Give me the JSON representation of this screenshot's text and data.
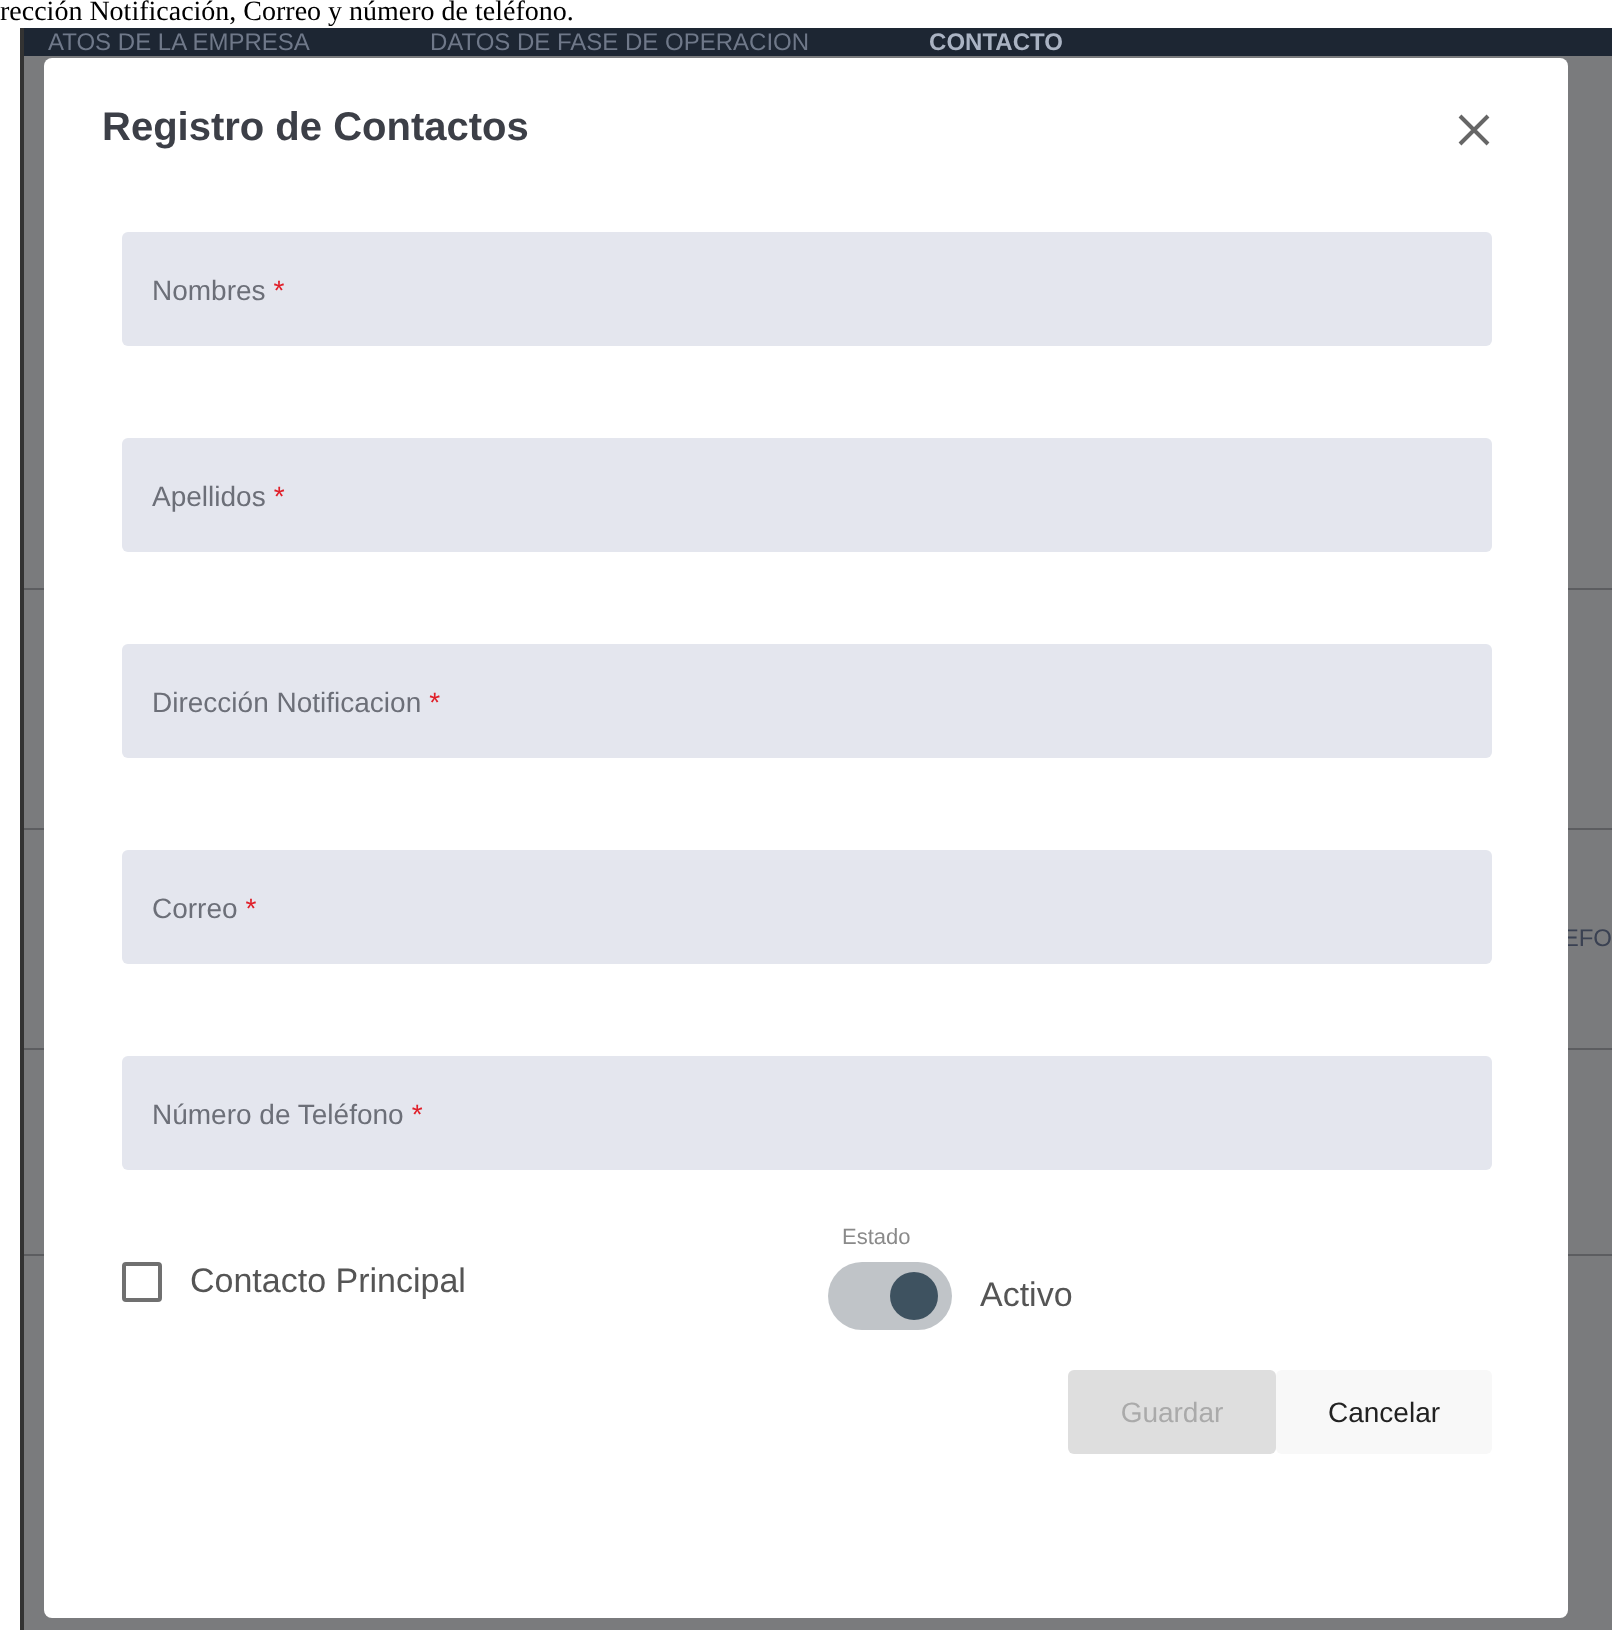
{
  "caption": "rección Notificación, Correo y número de teléfono.",
  "background": {
    "tabs": [
      {
        "label": "ATOS DE LA EMPRESA",
        "selected": false
      },
      {
        "label": "DATOS DE FASE DE OPERACION",
        "selected": false
      },
      {
        "label": "CONTACTO",
        "selected": true
      }
    ],
    "column_edge": "EFO"
  },
  "dialog": {
    "title": "Registro de Contactos",
    "fields": [
      {
        "label": "Nombres",
        "required_mark": "*"
      },
      {
        "label": "Apellidos",
        "required_mark": "*"
      },
      {
        "label": "Dirección Notificacion",
        "required_mark": "*"
      },
      {
        "label": "Correo",
        "required_mark": "*"
      },
      {
        "label": "Número de Teléfono",
        "required_mark": "*"
      }
    ],
    "checkbox": {
      "label": "Contacto Principal",
      "checked": false
    },
    "toggle": {
      "caption": "Estado",
      "label": "Activo",
      "on": true
    },
    "buttons": [
      {
        "label": "Guardar",
        "disabled": true
      },
      {
        "label": "Cancelar",
        "disabled": false
      }
    ]
  }
}
